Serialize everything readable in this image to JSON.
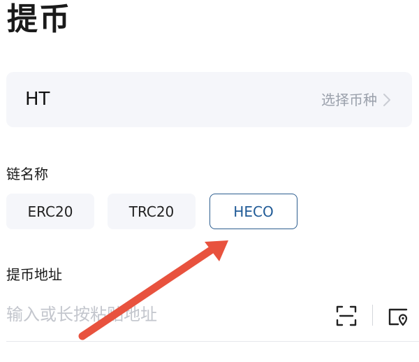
{
  "page": {
    "title": "提币"
  },
  "coin": {
    "value": "HT",
    "select_label": "选择币种"
  },
  "chain": {
    "label": "链名称",
    "options": [
      {
        "label": "ERC20",
        "selected": false
      },
      {
        "label": "TRC20",
        "selected": false
      },
      {
        "label": "HECO",
        "selected": true
      }
    ]
  },
  "address": {
    "label": "提币地址",
    "value": "",
    "placeholder": "输入或长按粘贴地址",
    "icons": [
      "scan-icon",
      "address-book-icon"
    ]
  },
  "colors": {
    "selected_border": "#2c5d8f",
    "selected_text": "#1f5a96",
    "annotation_arrow": "#e8523e",
    "chip_background": "#f5f6fa"
  }
}
